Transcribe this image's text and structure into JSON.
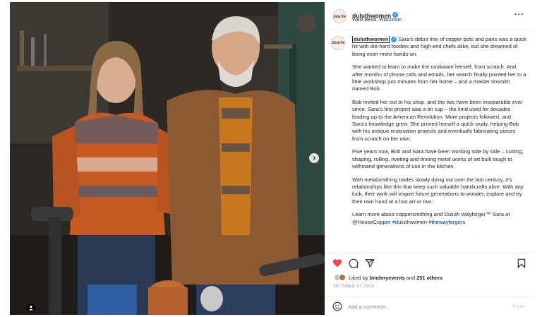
{
  "header": {
    "username": "duluthwomen",
    "location": "West Bend, Wisconsin",
    "avatar_text": "DULUTH",
    "more_icon": "more-horizontal-icon"
  },
  "caption": {
    "username": "duluthwomen",
    "intro": " Sara's debut line of copper pots and pans was a quick hit with die-hard foodies and high-end chefs alike, but she dreamed of being even more hands-on.",
    "paragraphs": [
      "She wanted to learn to make the cookware herself, from scratch. And after months of phone calls and emails, her search finally pointed her to a little workshop just minutes from her home – and a master tinsmith named Bob.",
      "Bob invited her out to his shop, and the two have been inseparable ever since. Sara's first project was a tin cup – the kind used for decades leading up to the American Revolution. More projects followed, and Sara's knowledge grew. She proved herself a quick study, helping Bob with his antique restoration projects and eventually fabricating pieces from scratch on her own.",
      "Five years now, Bob and Sara have been working side by side – cutting, shaping, rolling, riveting and tinning metal works of art built tough to withstand generations of use in the kitchen.",
      "With metalsmithing trades slowly dying out over the last century, it's relationships like this that keep such valuable handicrafts alive. With any luck, their work will inspire future generations to wonder, explore and try their own hand at a lost art or two."
    ],
    "last_paragraph": "Learn more about coppersmithing and Duluth Wayforger™ Sara at ",
    "tags": [
      "@HouseCopper",
      "#duluthwomen",
      "#thewayforgers"
    ]
  },
  "actions": {
    "like_icon": "heart-filled-icon",
    "comment_icon": "comment-icon",
    "share_icon": "share-icon",
    "save_icon": "bookmark-icon",
    "like_color": "#ed4956"
  },
  "likes": {
    "prefix": "Liked by ",
    "user": "binderyevents",
    "joiner": " and ",
    "others": "251 others"
  },
  "date": "OCTOBER 27, 2020",
  "comment": {
    "placeholder": "Add a comment...",
    "post_label": "Post",
    "emoji_icon": "emoji-icon"
  },
  "colors": {
    "link": "#00376b",
    "verified": "#3897f0",
    "muted": "#8e8e8e"
  }
}
